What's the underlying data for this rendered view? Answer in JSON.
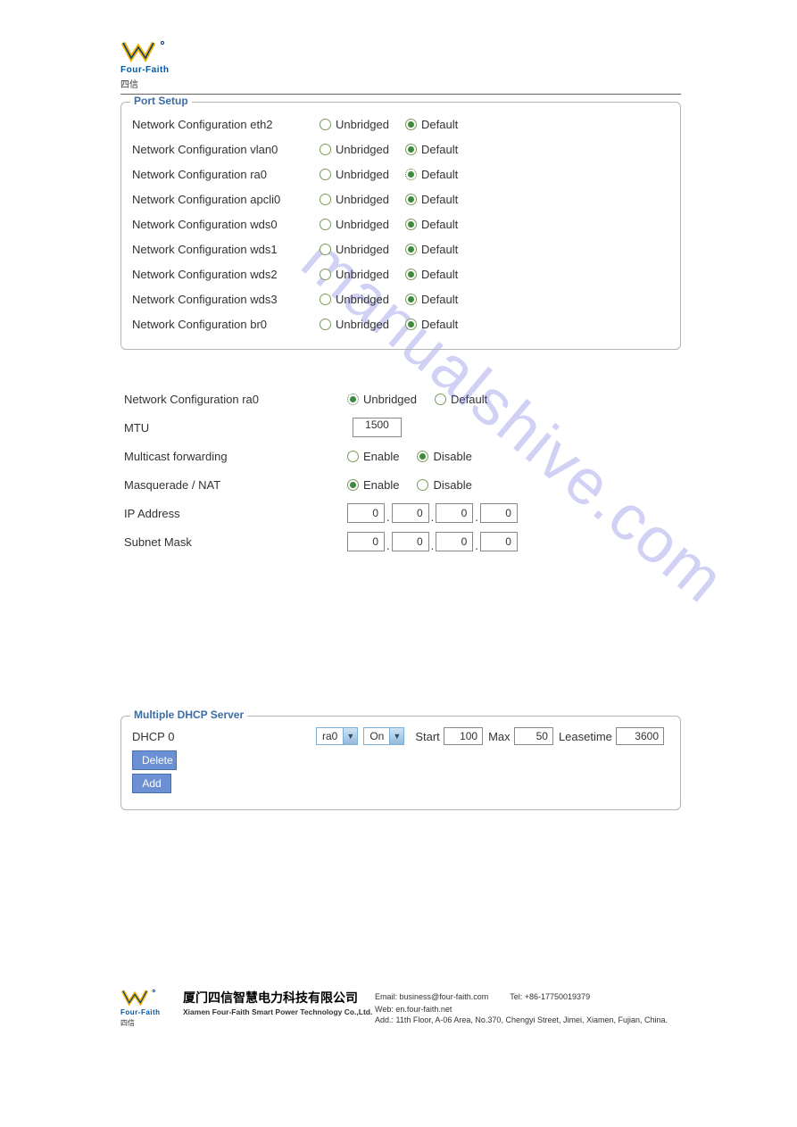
{
  "brand": {
    "name": "Four-Faith",
    "sub": "四信"
  },
  "watermark": "manualshive.com",
  "port_setup": {
    "title": "Port Setup",
    "opt_unbridged": "Unbridged",
    "opt_default": "Default",
    "rows": [
      {
        "label": "Network Configuration eth2",
        "selected": "default",
        "dotted": false
      },
      {
        "label": "Network Configuration vlan0",
        "selected": "default",
        "dotted": false
      },
      {
        "label": "Network Configuration ra0",
        "selected": "default",
        "dotted": true
      },
      {
        "label": "Network Configuration apcli0",
        "selected": "default",
        "dotted": false
      },
      {
        "label": "Network Configuration wds0",
        "selected": "default",
        "dotted": false
      },
      {
        "label": "Network Configuration wds1",
        "selected": "default",
        "dotted": false
      },
      {
        "label": "Network Configuration wds2",
        "selected": "default",
        "dotted": false
      },
      {
        "label": "Network Configuration wds3",
        "selected": "default",
        "dotted": false
      },
      {
        "label": "Network Configuration br0",
        "selected": "default",
        "dotted": false
      }
    ]
  },
  "detail": {
    "heading": "Network Configuration ra0",
    "opt_unbridged": "Unbridged",
    "opt_default": "Default",
    "heading_selected": "unbridged",
    "heading_dotted": true,
    "mtu_label": "MTU",
    "mtu_value": "1500",
    "multicast_label": "Multicast forwarding",
    "multicast_selected": "disable",
    "masq_label": "Masquerade / NAT",
    "masq_selected": "enable",
    "enable": "Enable",
    "disable": "Disable",
    "ip_label": "IP Address",
    "ip": [
      "0",
      "0",
      "0",
      "0"
    ],
    "mask_label": "Subnet Mask",
    "mask": [
      "0",
      "0",
      "0",
      "0"
    ]
  },
  "dhcp": {
    "title": "Multiple DHCP Server",
    "row_label": "DHCP 0",
    "iface": "ra0",
    "state": "On",
    "start_label": "Start",
    "start": "100",
    "max_label": "Max",
    "max": "50",
    "lease_label": "Leasetime",
    "lease": "3600",
    "delete": "Delete",
    "add": "Add"
  },
  "footer": {
    "company_cn": "厦门四信智慧电力科技有限公司",
    "company_en": "Xiamen Four-Faith Smart Power Technology Co.,Ltd.",
    "email_label": "Email:",
    "email": "business@four-faith.com",
    "tel_label": "Tel:",
    "tel": "+86-17750019379",
    "web_label": "Web:",
    "web": "en.four-faith.net",
    "addr_label": "Add.:",
    "addr": "11th Floor, A-06 Area, No.370, Chengyi Street, Jimei, Xiamen, Fujian, China."
  }
}
